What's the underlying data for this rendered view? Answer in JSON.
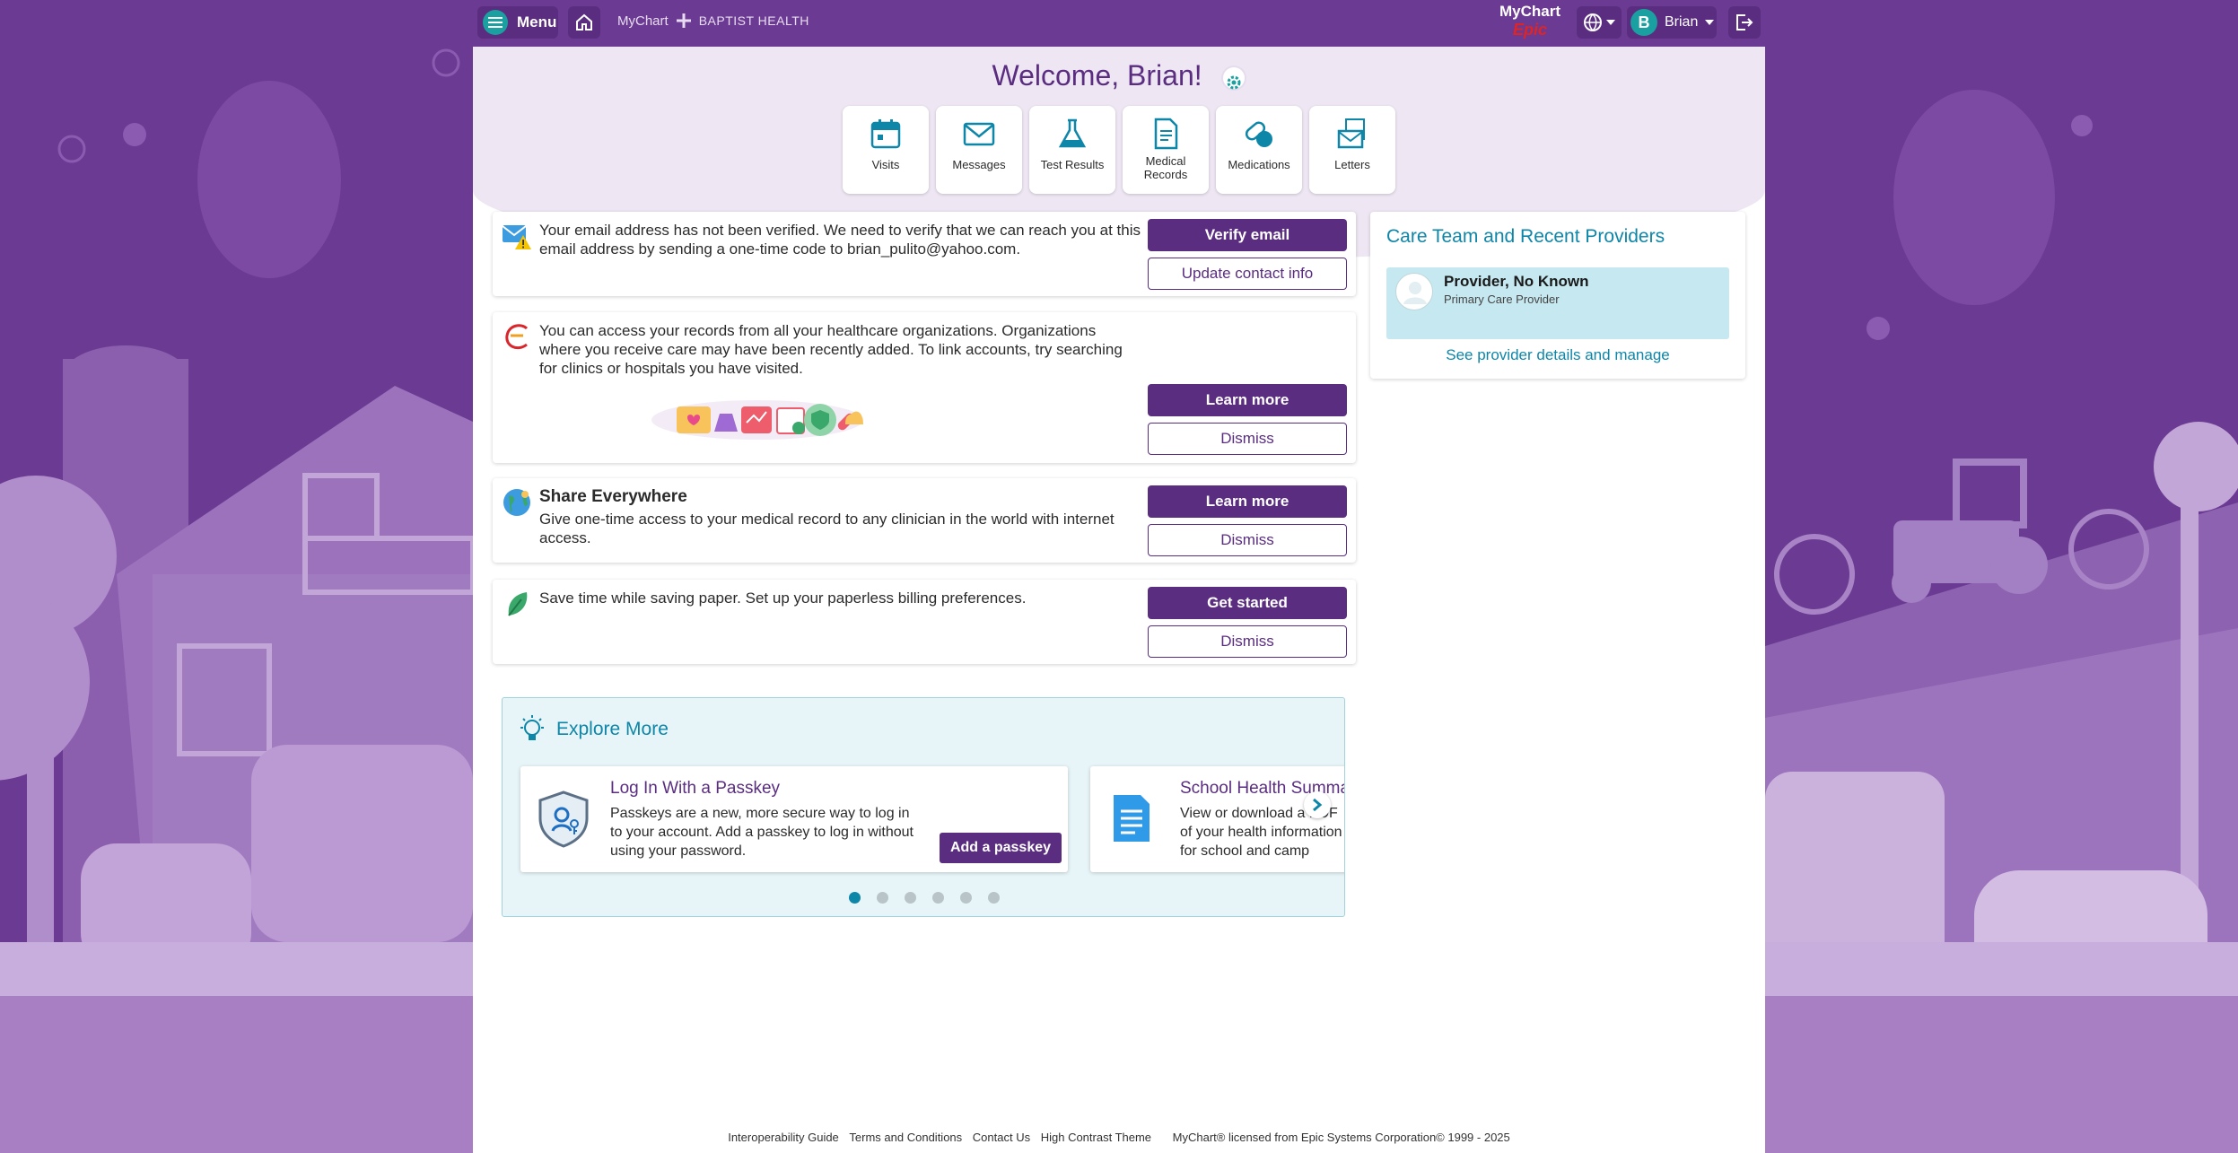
{
  "header": {
    "menu_label": "Menu",
    "brand_mychart": "MyChart",
    "brand_org": "BAPTIST HEALTH",
    "logo_line1": "MyChart",
    "logo_line2": "Epic",
    "user_initial": "B",
    "user_name": "Brian"
  },
  "welcome": "Welcome, Brian!",
  "quick_links": [
    {
      "label": "Visits",
      "icon": "calendar-icon"
    },
    {
      "label": "Messages",
      "icon": "envelope-icon"
    },
    {
      "label": "Test Results",
      "icon": "flask-icon"
    },
    {
      "label": "Medical Records",
      "icon": "document-icon"
    },
    {
      "label": "Medications",
      "icon": "pills-icon"
    },
    {
      "label": "Letters",
      "icon": "letters-icon"
    }
  ],
  "cards": {
    "email": {
      "text": "Your email address has not been verified. We need to verify that we can reach you at this email address by sending a one-time code to brian_pulito@yahoo.com.",
      "primary": "Verify email",
      "secondary": "Update contact info"
    },
    "records": {
      "text": "You can access your records from all your healthcare organizations. Organizations where you receive care may have been recently added. To link accounts, try searching for clinics or hospitals you have visited.",
      "primary": "Learn more",
      "secondary": "Dismiss"
    },
    "share": {
      "title": "Share Everywhere",
      "text": "Give one-time access to your medical record to any clinician in the world with internet access.",
      "primary": "Learn more",
      "secondary": "Dismiss"
    },
    "paperless": {
      "text": "Save time while saving paper. Set up your paperless billing preferences.",
      "primary": "Get started",
      "secondary": "Dismiss"
    }
  },
  "care_team": {
    "title": "Care Team and Recent Providers",
    "provider_name": "Provider, No Known",
    "provider_role": "Primary Care Provider",
    "link": "See provider details and manage"
  },
  "explore": {
    "title": "Explore More",
    "cards": [
      {
        "title": "Log In With a Passkey",
        "desc": "Passkeys are a new, more secure way to log in to your account. Add a passkey to log in without using your password.",
        "button": "Add a passkey"
      },
      {
        "title": "School Health Summary",
        "desc": "View or download a PDF of your health information for school and camp medical forms."
      }
    ]
  },
  "footer": {
    "links": [
      "Interoperability Guide",
      "Terms and Conditions",
      "Contact Us",
      "High Contrast Theme"
    ],
    "copyright": "MyChart® licensed from Epic Systems Corporation© 1999 - 2025"
  }
}
